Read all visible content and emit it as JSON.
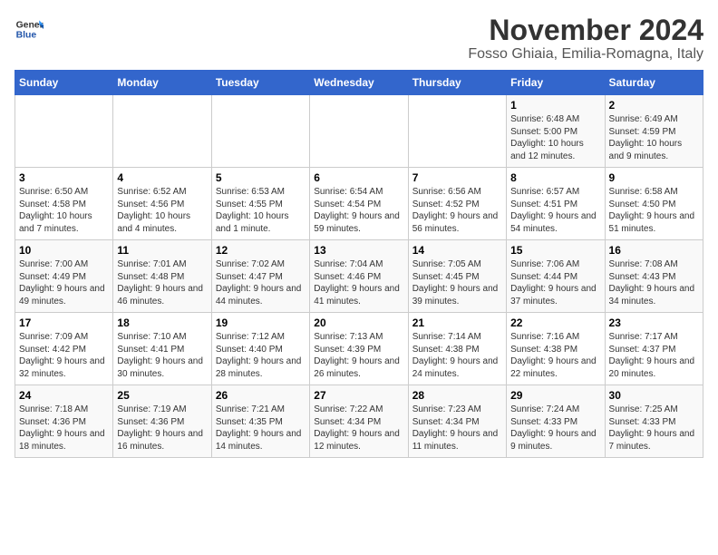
{
  "logo": {
    "general": "General",
    "blue": "Blue"
  },
  "header": {
    "month": "November 2024",
    "location": "Fosso Ghiaia, Emilia-Romagna, Italy"
  },
  "weekdays": [
    "Sunday",
    "Monday",
    "Tuesday",
    "Wednesday",
    "Thursday",
    "Friday",
    "Saturday"
  ],
  "weeks": [
    [
      {
        "day": "",
        "info": ""
      },
      {
        "day": "",
        "info": ""
      },
      {
        "day": "",
        "info": ""
      },
      {
        "day": "",
        "info": ""
      },
      {
        "day": "",
        "info": ""
      },
      {
        "day": "1",
        "info": "Sunrise: 6:48 AM\nSunset: 5:00 PM\nDaylight: 10 hours and 12 minutes."
      },
      {
        "day": "2",
        "info": "Sunrise: 6:49 AM\nSunset: 4:59 PM\nDaylight: 10 hours and 9 minutes."
      }
    ],
    [
      {
        "day": "3",
        "info": "Sunrise: 6:50 AM\nSunset: 4:58 PM\nDaylight: 10 hours and 7 minutes."
      },
      {
        "day": "4",
        "info": "Sunrise: 6:52 AM\nSunset: 4:56 PM\nDaylight: 10 hours and 4 minutes."
      },
      {
        "day": "5",
        "info": "Sunrise: 6:53 AM\nSunset: 4:55 PM\nDaylight: 10 hours and 1 minute."
      },
      {
        "day": "6",
        "info": "Sunrise: 6:54 AM\nSunset: 4:54 PM\nDaylight: 9 hours and 59 minutes."
      },
      {
        "day": "7",
        "info": "Sunrise: 6:56 AM\nSunset: 4:52 PM\nDaylight: 9 hours and 56 minutes."
      },
      {
        "day": "8",
        "info": "Sunrise: 6:57 AM\nSunset: 4:51 PM\nDaylight: 9 hours and 54 minutes."
      },
      {
        "day": "9",
        "info": "Sunrise: 6:58 AM\nSunset: 4:50 PM\nDaylight: 9 hours and 51 minutes."
      }
    ],
    [
      {
        "day": "10",
        "info": "Sunrise: 7:00 AM\nSunset: 4:49 PM\nDaylight: 9 hours and 49 minutes."
      },
      {
        "day": "11",
        "info": "Sunrise: 7:01 AM\nSunset: 4:48 PM\nDaylight: 9 hours and 46 minutes."
      },
      {
        "day": "12",
        "info": "Sunrise: 7:02 AM\nSunset: 4:47 PM\nDaylight: 9 hours and 44 minutes."
      },
      {
        "day": "13",
        "info": "Sunrise: 7:04 AM\nSunset: 4:46 PM\nDaylight: 9 hours and 41 minutes."
      },
      {
        "day": "14",
        "info": "Sunrise: 7:05 AM\nSunset: 4:45 PM\nDaylight: 9 hours and 39 minutes."
      },
      {
        "day": "15",
        "info": "Sunrise: 7:06 AM\nSunset: 4:44 PM\nDaylight: 9 hours and 37 minutes."
      },
      {
        "day": "16",
        "info": "Sunrise: 7:08 AM\nSunset: 4:43 PM\nDaylight: 9 hours and 34 minutes."
      }
    ],
    [
      {
        "day": "17",
        "info": "Sunrise: 7:09 AM\nSunset: 4:42 PM\nDaylight: 9 hours and 32 minutes."
      },
      {
        "day": "18",
        "info": "Sunrise: 7:10 AM\nSunset: 4:41 PM\nDaylight: 9 hours and 30 minutes."
      },
      {
        "day": "19",
        "info": "Sunrise: 7:12 AM\nSunset: 4:40 PM\nDaylight: 9 hours and 28 minutes."
      },
      {
        "day": "20",
        "info": "Sunrise: 7:13 AM\nSunset: 4:39 PM\nDaylight: 9 hours and 26 minutes."
      },
      {
        "day": "21",
        "info": "Sunrise: 7:14 AM\nSunset: 4:38 PM\nDaylight: 9 hours and 24 minutes."
      },
      {
        "day": "22",
        "info": "Sunrise: 7:16 AM\nSunset: 4:38 PM\nDaylight: 9 hours and 22 minutes."
      },
      {
        "day": "23",
        "info": "Sunrise: 7:17 AM\nSunset: 4:37 PM\nDaylight: 9 hours and 20 minutes."
      }
    ],
    [
      {
        "day": "24",
        "info": "Sunrise: 7:18 AM\nSunset: 4:36 PM\nDaylight: 9 hours and 18 minutes."
      },
      {
        "day": "25",
        "info": "Sunrise: 7:19 AM\nSunset: 4:36 PM\nDaylight: 9 hours and 16 minutes."
      },
      {
        "day": "26",
        "info": "Sunrise: 7:21 AM\nSunset: 4:35 PM\nDaylight: 9 hours and 14 minutes."
      },
      {
        "day": "27",
        "info": "Sunrise: 7:22 AM\nSunset: 4:34 PM\nDaylight: 9 hours and 12 minutes."
      },
      {
        "day": "28",
        "info": "Sunrise: 7:23 AM\nSunset: 4:34 PM\nDaylight: 9 hours and 11 minutes."
      },
      {
        "day": "29",
        "info": "Sunrise: 7:24 AM\nSunset: 4:33 PM\nDaylight: 9 hours and 9 minutes."
      },
      {
        "day": "30",
        "info": "Sunrise: 7:25 AM\nSunset: 4:33 PM\nDaylight: 9 hours and 7 minutes."
      }
    ]
  ]
}
